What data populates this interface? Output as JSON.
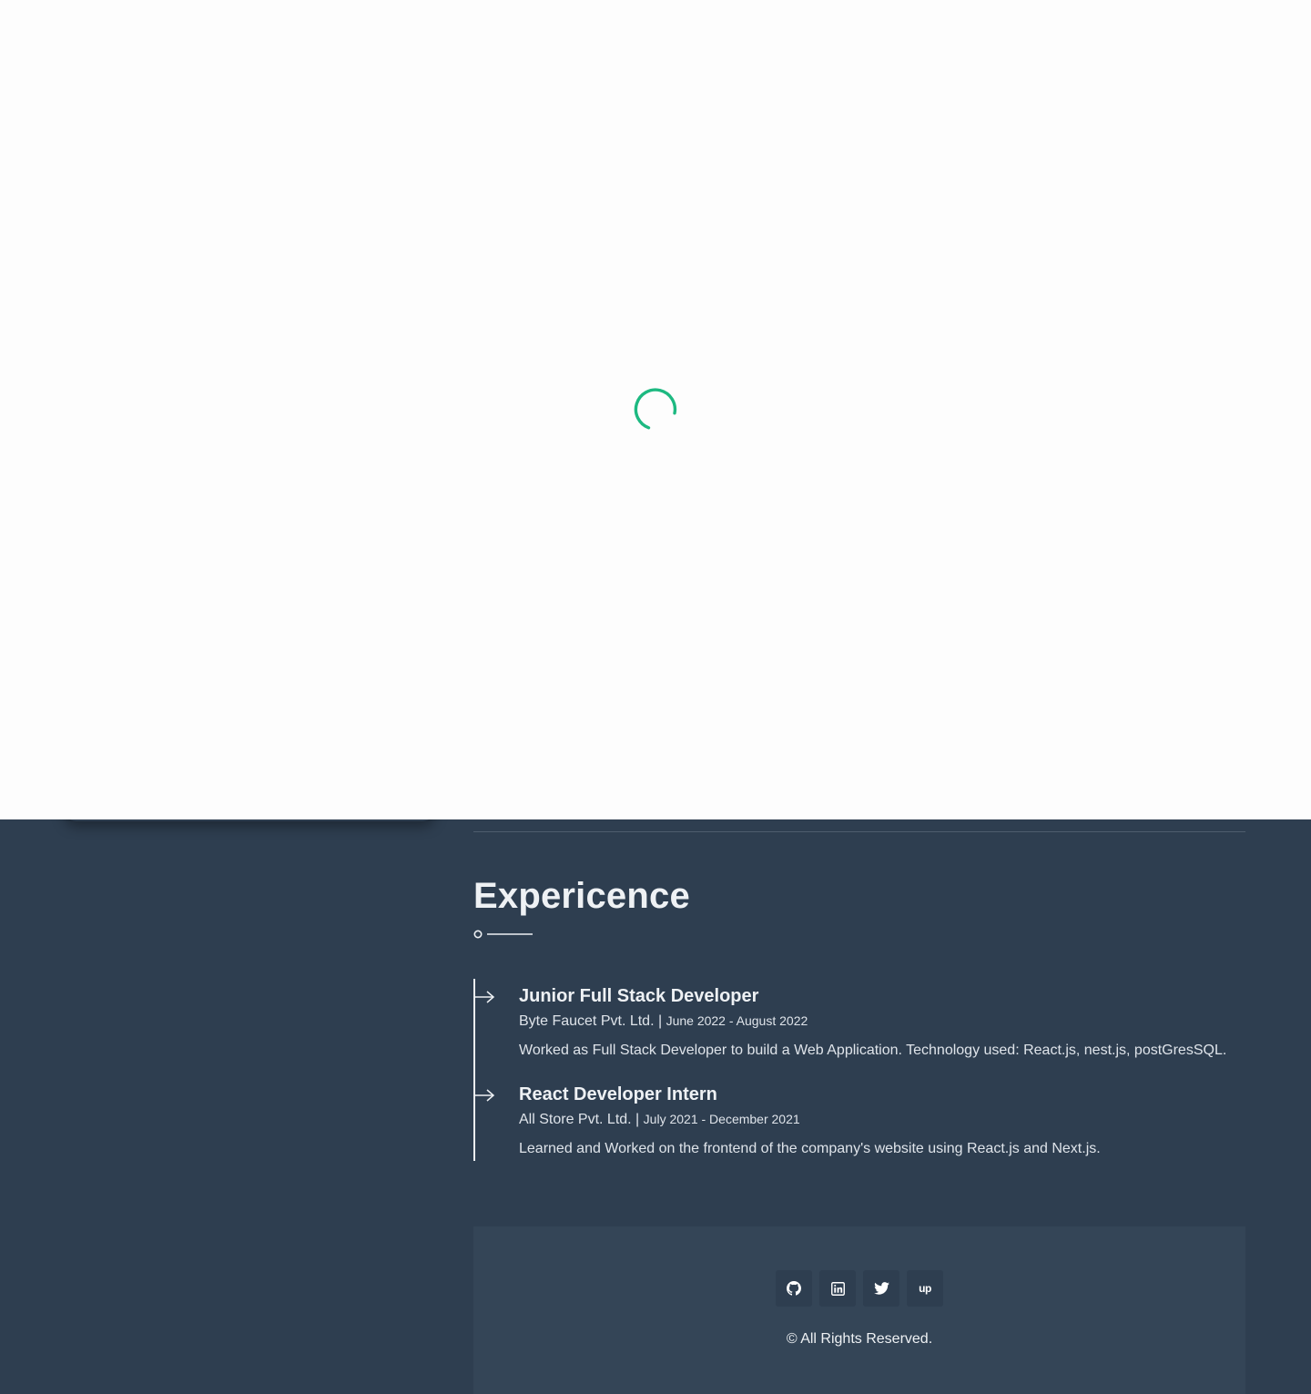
{
  "experience": {
    "title": "Expericence",
    "items": [
      {
        "role": "Junior Full Stack Developer",
        "company": "Byte Faucet Pvt. Ltd. |",
        "dates": "June 2022 - August 2022",
        "description": "Worked as Full Stack Developer to build a Web Application. Technology used: React.js, nest.js, postGresSQL."
      },
      {
        "role": "React Developer Intern",
        "company": "All Store Pvt. Ltd. |",
        "dates": "July 2021 - December 2021",
        "description": "Learned and Worked on the frontend of the company's website using React.js and Next.js."
      }
    ]
  },
  "footer": {
    "social_icons": [
      "github-icon",
      "linkedin-icon",
      "twitter-icon",
      "upwork-icon"
    ],
    "upwork_glyph": "up",
    "copyright": "© All Rights Reserved."
  },
  "colors": {
    "background": "#2e3e50",
    "footer_background": "#344557",
    "spinner_accent": "#1db981",
    "overlay": "#fdfdfd"
  },
  "loading": {
    "icon": "loading-spinner-icon"
  }
}
